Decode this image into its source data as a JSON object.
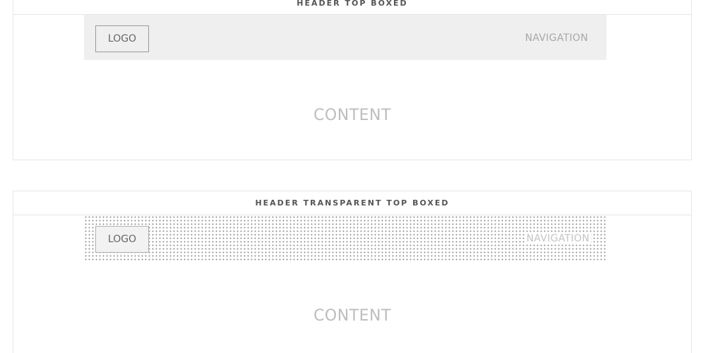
{
  "layouts": [
    {
      "title": "HEADER TOP BOXED",
      "logo": "LOGO",
      "navigation": "NAVIGATION",
      "content": "CONTENT"
    },
    {
      "title": "HEADER TRANSPARENT TOP BOXED",
      "logo": "LOGO",
      "navigation": "NAVIGATION",
      "content": "CONTENT"
    }
  ],
  "colors": {
    "border": "#e6e6e6",
    "header_fill": "#efefef",
    "text_muted": "#bdbdbd",
    "title_text": "#555555"
  }
}
